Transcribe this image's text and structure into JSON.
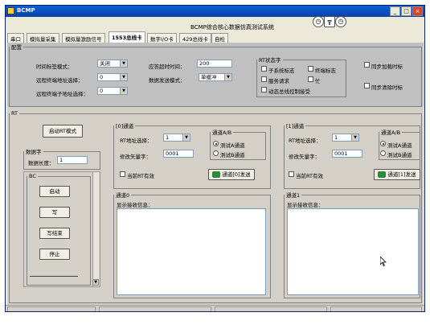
{
  "window": {
    "title": "BCMP",
    "app_title": "BCMP综合核心数据仿真测试系统",
    "min": "_",
    "max": "□",
    "close": "×"
  },
  "tabs": [
    {
      "label": "串口",
      "active": false
    },
    {
      "label": "模拟量采集",
      "active": false
    },
    {
      "label": "模拟量激励信号",
      "active": false
    },
    {
      "label": "1553总线卡",
      "active": true
    },
    {
      "label": "数字I/O卡",
      "active": false
    },
    {
      "label": "429总线卡",
      "active": false
    },
    {
      "label": "自检",
      "active": false
    }
  ],
  "config": {
    "legend": "配置",
    "time_mode_label": "时间标签模式：",
    "time_mode_value": "关闭",
    "remote_addr_label": "远程终端地址选择：",
    "remote_addr_value": "0",
    "remote_sub_label": "远程终端子地址选择：",
    "remote_sub_value": "0",
    "timeout_label": "应答超时时间：",
    "timeout_value": "200",
    "send_mode_label": "数据发送模式：",
    "send_mode_value": "单缓冲",
    "rt_status_legend": "RT状态字",
    "rt_flags": [
      "子系统标志",
      "终端标志",
      "服务请求",
      "忙",
      "动态总线控制接受"
    ],
    "sync_load_label": "同步加载时标",
    "sync_clear_label": "同步清除时标"
  },
  "rt": {
    "legend": "RT",
    "start_btn": "启动RT模式",
    "data_word_legend": "数据字",
    "data_len_label": "数据长度：",
    "data_len_value": "1",
    "bc_legend": "BC",
    "bc_buttons": [
      "启动",
      "写",
      "写结束",
      "停止"
    ]
  },
  "channel0": {
    "legend": "[0]通道",
    "addr_label": "RT地址选择：",
    "addr_value": "1",
    "vector_label": "修改矢量字：",
    "vector_value": "0001",
    "ab_legend": "通道A/B",
    "radio_a": "测试A通道",
    "radio_b": "测试B通道",
    "current_rt_label": "当前RT有效",
    "send_btn": "通道[0]发送",
    "recv_legend": "通道0",
    "recv_label": "显示接收信息："
  },
  "channel1": {
    "legend": "[1]通道",
    "addr_label": "RT地址选择：",
    "addr_value": "1",
    "vector_label": "修改矢量字：",
    "vector_value": "0001",
    "ab_legend": "通道A/B",
    "radio_a": "测试A通道",
    "radio_b": "测试B通道",
    "current_rt_label": "当前RT有效",
    "send_btn": "通道[1]发送",
    "recv_legend": "通道1",
    "recv_label": "显示接收信息："
  },
  "icons": [
    "app-icon",
    "clock-icon",
    "signal-icon",
    "mouse-cursor-icon"
  ]
}
